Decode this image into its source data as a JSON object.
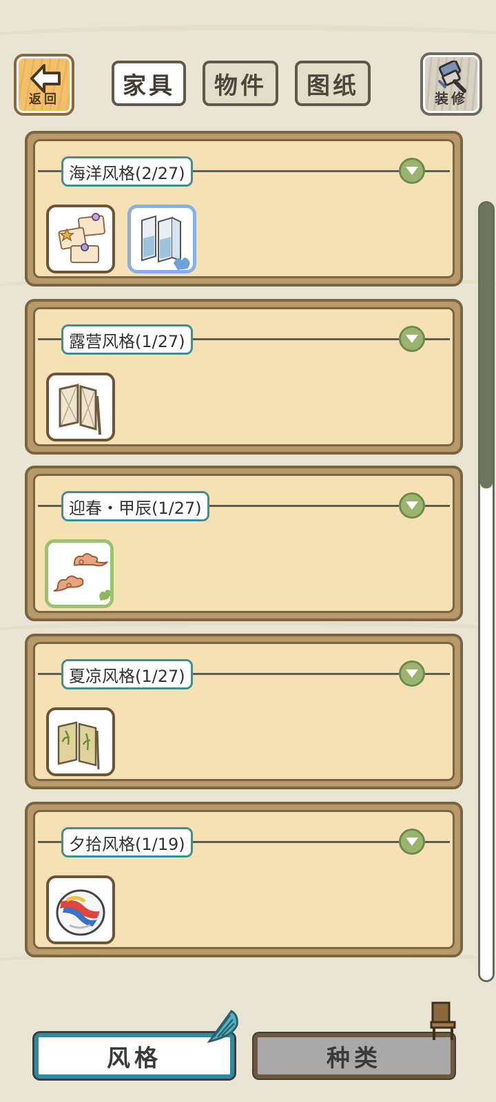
{
  "top_bar": {
    "back_label": "返回",
    "tabs": [
      {
        "label": "家具",
        "active": true
      },
      {
        "label": "物件",
        "active": false
      },
      {
        "label": "图纸",
        "active": false
      }
    ],
    "decorate_label": "装修"
  },
  "groups": [
    {
      "title": "海洋风格(2/27)",
      "items": [
        "memo-notes",
        "folding-screen-sea"
      ],
      "selected_item": "folding-screen-sea"
    },
    {
      "title": "露营风格(1/27)",
      "items": [
        "folding-screen-camp"
      ]
    },
    {
      "title": "迎春・甲辰(1/27)",
      "items": [
        "clouds"
      ],
      "selected_item": "clouds"
    },
    {
      "title": "夏凉风格(1/27)",
      "items": [
        "folding-screen-bamboo"
      ]
    },
    {
      "title": "夕拾风格(1/19)",
      "items": [
        "marble"
      ]
    }
  ],
  "bottom": {
    "style_label": "风格",
    "kind_label": "种类",
    "active": "style"
  },
  "colors": {
    "background": "#e9e5d4",
    "panel_fill": "#f6e1b4",
    "panel_border": "#7c6440",
    "title_border": "#3b8f98",
    "toggle": "#9ab36e",
    "accent_blue": "#2d8aa0"
  },
  "icons": [
    "back-arrow-icon",
    "brush-icon",
    "chevron-down-icon",
    "shell-icon",
    "chair-icon",
    "hand-pointer-icon",
    "paw-pointer-icon"
  ]
}
